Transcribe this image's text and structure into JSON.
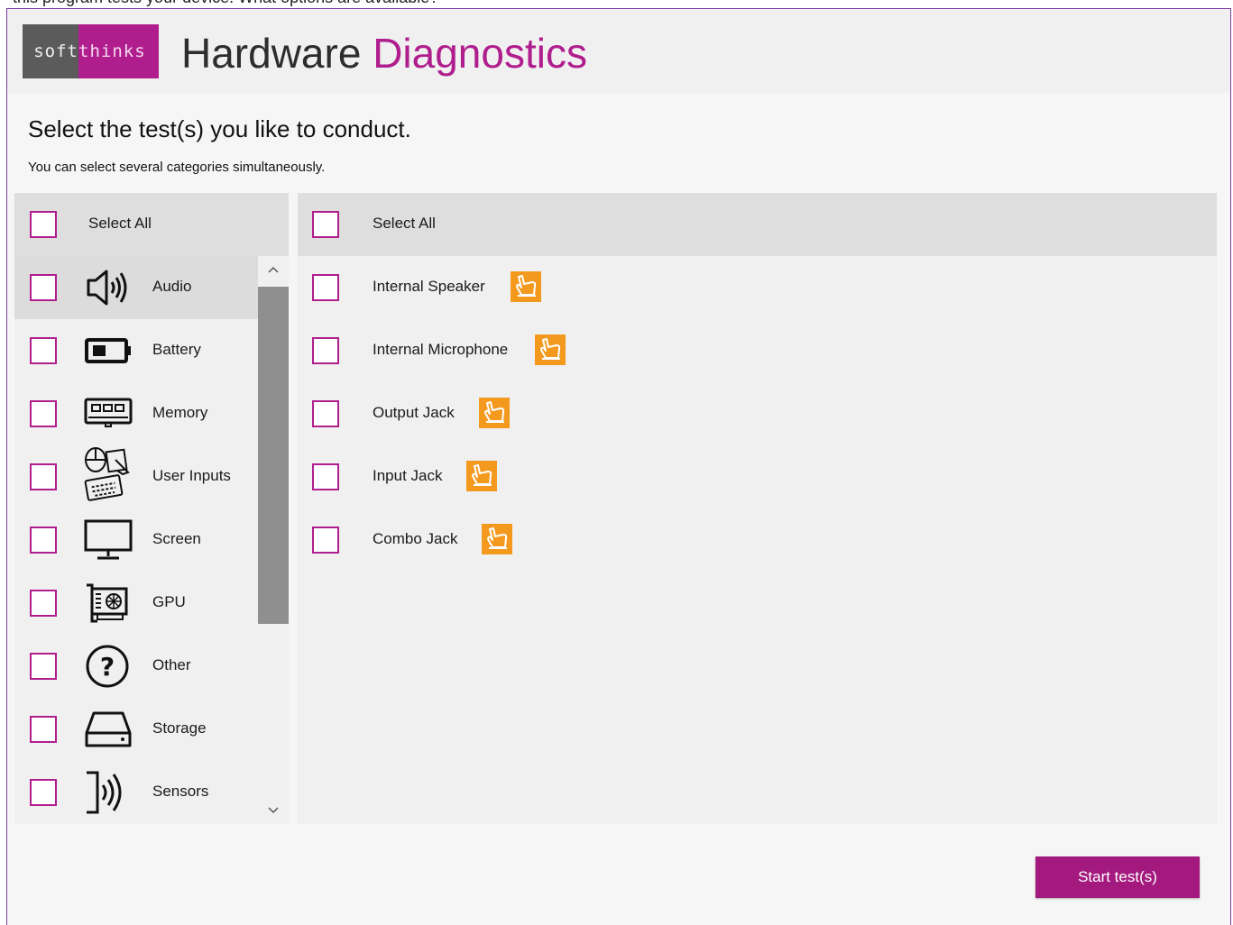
{
  "top_strip": {
    "text": "this program tests your device. What options are available?"
  },
  "header": {
    "logo_left": "soft",
    "logo_right": "thinks",
    "title_main": "Hardware",
    "title_accent": "Diagnostics"
  },
  "main": {
    "heading": "Select the test(s) you like to conduct.",
    "subheading": "You can select several categories simultaneously."
  },
  "categories": {
    "select_all": "Select All",
    "items": [
      {
        "label": "Audio",
        "icon": "speaker-icon",
        "selected": true
      },
      {
        "label": "Battery",
        "icon": "battery-icon",
        "selected": false
      },
      {
        "label": "Memory",
        "icon": "memory-icon",
        "selected": false
      },
      {
        "label": "User Inputs",
        "icon": "user-inputs-icon",
        "selected": false
      },
      {
        "label": "Screen",
        "icon": "monitor-icon",
        "selected": false
      },
      {
        "label": "GPU",
        "icon": "gpu-icon",
        "selected": false
      },
      {
        "label": "Other",
        "icon": "question-icon",
        "selected": false
      },
      {
        "label": "Storage",
        "icon": "storage-icon",
        "selected": false
      },
      {
        "label": "Sensors",
        "icon": "sensors-icon",
        "selected": false
      }
    ]
  },
  "tests": {
    "select_all": "Select All",
    "items": [
      {
        "label": "Internal Speaker",
        "interactive_icon": "hand-pointer-icon"
      },
      {
        "label": "Internal Microphone",
        "interactive_icon": "hand-pointer-icon"
      },
      {
        "label": "Output Jack",
        "interactive_icon": "hand-pointer-icon"
      },
      {
        "label": "Input Jack",
        "interactive_icon": "hand-pointer-icon"
      },
      {
        "label": "Combo Jack",
        "interactive_icon": "hand-pointer-icon"
      }
    ]
  },
  "footer": {
    "start_label": "Start test(s)"
  },
  "colors": {
    "accent": "#b01e8e",
    "button": "#a3197d",
    "interactive_icon": "#f39a1e",
    "logo_gray": "#5b5b5b"
  }
}
